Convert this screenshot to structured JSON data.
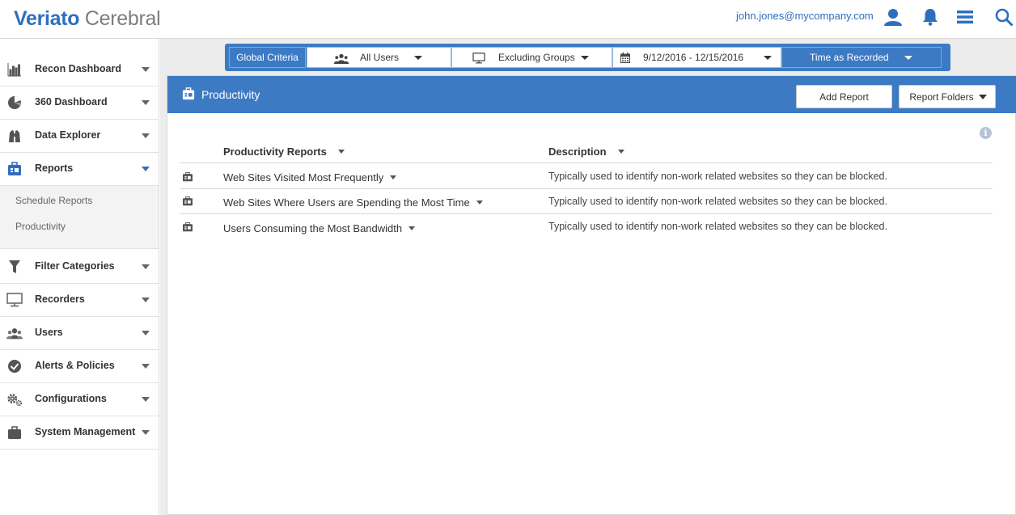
{
  "app": {
    "logo_bold": "Veriato",
    "logo_light": " Cerebral",
    "user_email": "john.jones@mycompany.com"
  },
  "sidebar": {
    "items": [
      {
        "label": "Recon Dashboard",
        "icon": "bar-chart-icon"
      },
      {
        "label": "360 Dashboard",
        "icon": "pie-chart-icon"
      },
      {
        "label": "Data Explorer",
        "icon": "binoculars-icon"
      },
      {
        "label": "Reports",
        "icon": "briefcase-report-icon",
        "active": true
      },
      {
        "label": "Filter Categories",
        "icon": "filter-icon"
      },
      {
        "label": "Recorders",
        "icon": "monitor-icon"
      },
      {
        "label": "Users",
        "icon": "users-icon"
      },
      {
        "label": "Alerts & Policies",
        "icon": "check-circle-icon"
      },
      {
        "label": "Configurations",
        "icon": "gears-icon"
      },
      {
        "label": "System Management",
        "icon": "briefcase-icon"
      }
    ],
    "reports_sub": [
      "Schedule Reports",
      "Productivity"
    ]
  },
  "global_criteria": {
    "label": "Global Criteria",
    "users": "All Users",
    "groups": "Excluding Groups",
    "date_range": "9/12/2016 - 12/15/2016",
    "time_mode": "Time as Recorded"
  },
  "panel": {
    "title": "Productivity",
    "add_report": "Add Report",
    "report_folders": "Report Folders",
    "col_reports": "Productivity Reports",
    "col_description": "Description",
    "rows": [
      {
        "name": "Web Sites Visited Most Frequently",
        "description": "Typically used to identify non-work related websites so they can be blocked."
      },
      {
        "name": "Web Sites Where Users are Spending the Most Time",
        "description": "Typically used to identify non-work related websites so they can be blocked."
      },
      {
        "name": "Users Consuming the Most Bandwidth",
        "description": "Typically used to identify non-work related websites so they can be blocked."
      }
    ]
  },
  "colors": {
    "brand_blue": "#3c7ac4",
    "logo_blue": "#2e6fbd"
  }
}
